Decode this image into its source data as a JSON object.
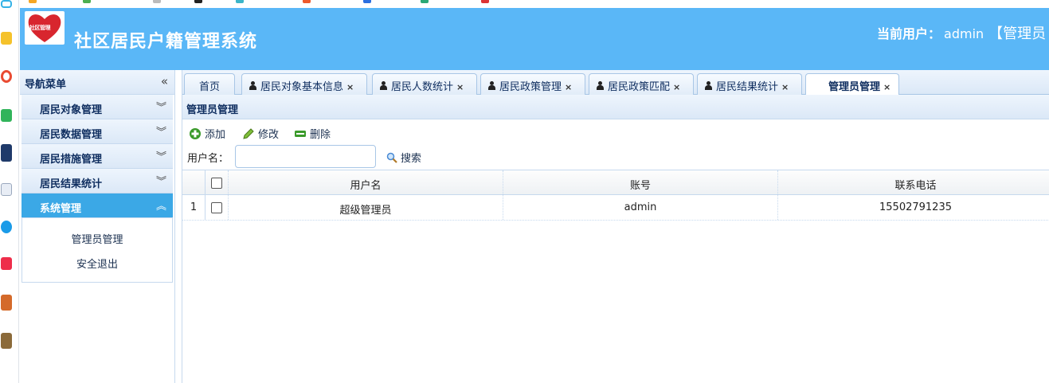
{
  "header": {
    "app_title": "社区居民户籍管理系统",
    "logo_text": "社区管理",
    "current_user_label": "当前用户：",
    "current_user_value": "admin",
    "current_user_role": "【管理员"
  },
  "sidebar": {
    "title": "导航菜单",
    "sections": [
      {
        "label": "居民对象管理",
        "expanded": false
      },
      {
        "label": "居民数据管理",
        "expanded": false
      },
      {
        "label": "居民措施管理",
        "expanded": false
      },
      {
        "label": "居民结果统计",
        "expanded": false
      },
      {
        "label": "系统管理",
        "expanded": true
      }
    ],
    "sub_items": [
      "管理员管理",
      "安全退出"
    ]
  },
  "tabs": [
    {
      "label": "首页",
      "closable": false,
      "icon": "none",
      "active": false
    },
    {
      "label": "居民对象基本信息",
      "closable": true,
      "icon": "person-icon",
      "active": false
    },
    {
      "label": "居民人数统计",
      "closable": true,
      "icon": "person-icon",
      "active": false
    },
    {
      "label": "居民政策管理",
      "closable": true,
      "icon": "person-icon",
      "active": false
    },
    {
      "label": "居民政策匹配",
      "closable": true,
      "icon": "person-icon",
      "active": false
    },
    {
      "label": "居民结果统计",
      "closable": true,
      "icon": "person-icon",
      "active": false
    },
    {
      "label": "管理员管理",
      "closable": true,
      "icon": "none",
      "active": true
    }
  ],
  "panel": {
    "title": "管理员管理"
  },
  "toolbar": {
    "add_label": "添加",
    "edit_label": "修改",
    "delete_label": "删除"
  },
  "search": {
    "label": "用户名：",
    "value": "",
    "button_label": "搜索"
  },
  "table": {
    "columns": [
      "用户名",
      "账号",
      "联系电话"
    ],
    "rows": [
      {
        "num": "1",
        "username": "超级管理员",
        "account": "admin",
        "phone": "15502791235"
      }
    ]
  },
  "colors": {
    "header_bg": "#5ab7f7",
    "active_nav_bg": "#3ba8e6"
  }
}
